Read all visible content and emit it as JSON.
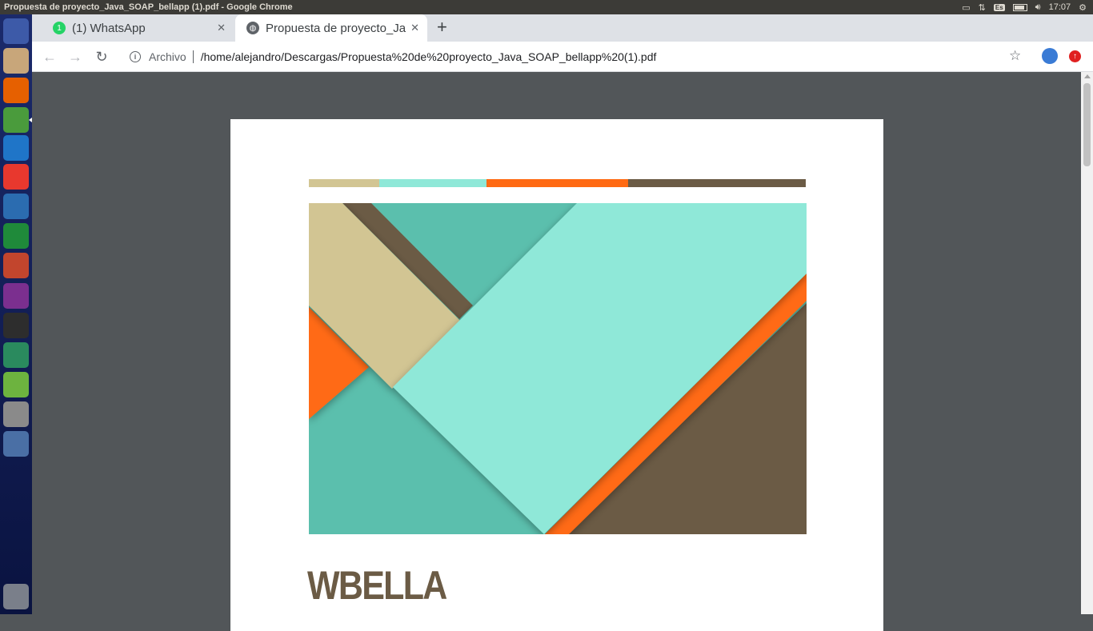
{
  "system": {
    "window_title": "Propuesta de proyecto_Java_SOAP_bellapp (1).pdf - Google Chrome",
    "keyboard_layout": "Es",
    "clock": "17:07"
  },
  "tabs": [
    {
      "label": "(1) WhatsApp",
      "badge": "1",
      "icon": "whatsapp-icon"
    },
    {
      "label": "Propuesta de proyecto_Ja",
      "icon": "globe-icon"
    }
  ],
  "toolbar": {
    "security_chip": "Archivo",
    "url": "/home/alejandro/Descargas/Propuesta%20de%20proyecto_Java_SOAP_bellapp%20(1).pdf"
  },
  "launcher": [
    {
      "name": "ubuntu-dash-icon",
      "color": "#3d5aa8"
    },
    {
      "name": "files-icon",
      "color": "#c8a67a"
    },
    {
      "name": "firefox-icon",
      "color": "#e66000"
    },
    {
      "name": "chrome-icon",
      "color": "#4a9b3c"
    },
    {
      "name": "vscode-icon",
      "color": "#1f75c8"
    },
    {
      "name": "anydesk-icon",
      "color": "#e8382e"
    },
    {
      "name": "libreoffice-writer-icon",
      "color": "#2b6cb0"
    },
    {
      "name": "libreoffice-calc-icon",
      "color": "#1f8a3a"
    },
    {
      "name": "libreoffice-impress-icon",
      "color": "#c2452d"
    },
    {
      "name": "purple-app-icon",
      "color": "#7b2f8f"
    },
    {
      "name": "terminal-icon",
      "color": "#2d2d2d"
    },
    {
      "name": "android-studio-icon",
      "color": "#2a8a5e"
    },
    {
      "name": "spring-tool-icon",
      "color": "#6db33f"
    },
    {
      "name": "help-icon",
      "color": "#8a8a8a"
    },
    {
      "name": "remote-desktop-icon",
      "color": "#4a6fa5"
    }
  ],
  "document": {
    "title": "WBELLA",
    "stripe_colors": [
      "#d2c593",
      "#8fe8d8",
      "#ff6a13",
      "#6b5b45"
    ],
    "stripe_fractions": [
      0.142,
      0.215,
      0.286,
      0.357
    ]
  },
  "colors": {
    "teal": "#5bbfad",
    "mint": "#8fe8d8",
    "orange": "#ff6a13",
    "brown": "#6b5b45",
    "sand": "#d2c593"
  }
}
